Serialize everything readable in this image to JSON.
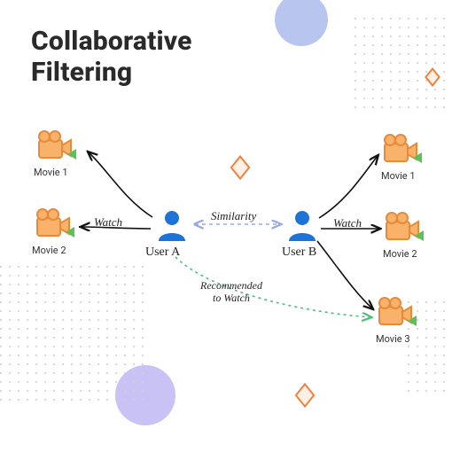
{
  "title_line1": "Collaborative",
  "title_line2": "Filtering",
  "users": {
    "a": {
      "label": "User A"
    },
    "b": {
      "label": "User B"
    }
  },
  "movies_left": [
    {
      "label": "Movie 1"
    },
    {
      "label": "Movie 2"
    }
  ],
  "movies_right": [
    {
      "label": "Movie 1"
    },
    {
      "label": "Movie 2"
    },
    {
      "label": "Movie 3"
    }
  ],
  "edges": {
    "watch_left": "Watch",
    "watch_right": "Watch",
    "similarity": "Similarity",
    "recommended_line1": "Recommended",
    "recommended_line2": "to Watch"
  },
  "colors": {
    "user": "#1e73d6",
    "camera_body": "#f9b26a",
    "camera_dark": "#e68a3c",
    "play": "#5cc05c",
    "arrow": "#111111",
    "sim_arrow": "#98a9e6",
    "rec_arrow": "#4fbf7a"
  }
}
